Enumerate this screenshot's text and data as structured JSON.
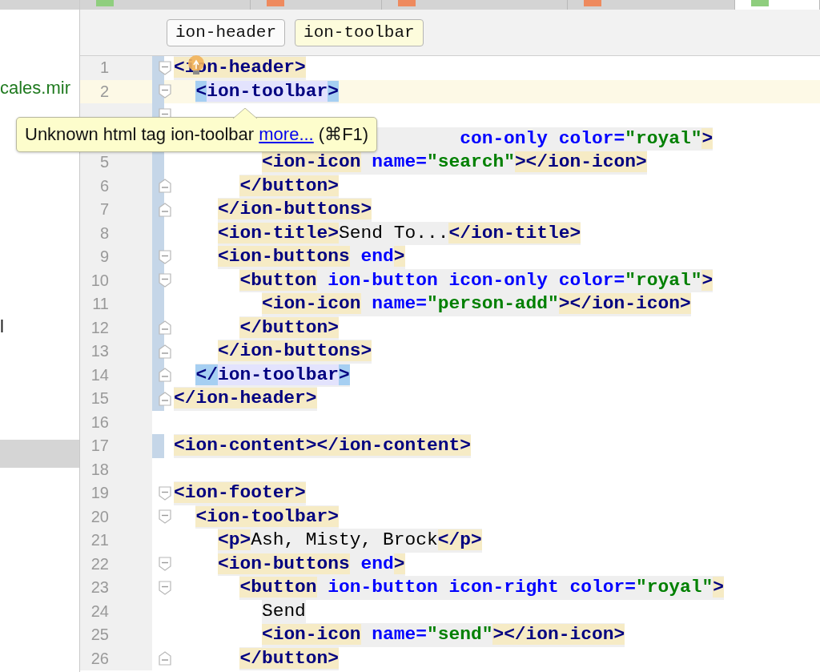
{
  "project_panel": {
    "items": [
      {
        "text": "cales.mir",
        "color": "#1f7a1f",
        "selected": false
      },
      {
        "text": "l",
        "color": "#1a1a1a",
        "selected": false
      },
      {
        "selected": true
      }
    ]
  },
  "editor_tabs": [
    {
      "color": "#8fce7e",
      "selected": false
    },
    {
      "color": "#ee8a5e",
      "selected": false
    },
    {
      "color": "#ee8a5e",
      "selected": false
    },
    {
      "color": "#ee8a5e",
      "selected": false
    },
    {
      "color": "#8fce7e",
      "selected": true
    }
  ],
  "breadcrumbs": [
    {
      "label": "ion-header",
      "selected": false
    },
    {
      "label": "ion-toolbar",
      "selected": true
    }
  ],
  "code": [
    {
      "number": "1",
      "kind": "fold_start",
      "in_scope": true,
      "tokens": [
        {
          "kind": "tag",
          "text": "<ion-header>"
        }
      ],
      "children": [
        {
          "number": "2",
          "kind": "fold_start",
          "in_scope": true,
          "current": true,
          "tokens": [
            {
              "kind": "match_bracket",
              "text": "<"
            },
            {
              "kind": "match_tag",
              "text": "ion-toolbar"
            },
            {
              "kind": "match_bracket",
              "text": ">"
            }
          ],
          "children": [
            {
              "kind": "fold_start",
              "in_scope": true,
              "children": [
                {
                  "tokens": [
                    {
                      "kind": "attr",
                      "text": "                    con-only"
                    },
                    {
                      "kind": "attr",
                      "text": " color="
                    },
                    {
                      "kind": "value",
                      "text": "\"royal\""
                    },
                    {
                      "kind": "tag",
                      "text": ">"
                    }
                  ],
                  "children": [
                    {
                      "number": "5",
                      "in_scope": true,
                      "tokens": [
                        {
                          "kind": "tag",
                          "text": "<ion-icon"
                        },
                        {
                          "kind": "attr",
                          "text": " name="
                        },
                        {
                          "kind": "value",
                          "text": "\"search\""
                        },
                        {
                          "kind": "tag",
                          "text": "></ion-icon>"
                        }
                      ]
                    }
                  ]
                },
                {
                  "number": "6",
                  "kind": "fold_end",
                  "in_scope": true,
                  "tokens": [
                    {
                      "kind": "tag",
                      "text": "</button>"
                    }
                  ]
                }
              ]
            },
            {
              "number": "7",
              "kind": "fold_end",
              "in_scope": true,
              "tokens": [
                {
                  "kind": "tag",
                  "text": "</ion-buttons>"
                }
              ]
            },
            {
              "number": "8",
              "in_scope": true,
              "tokens": [
                {
                  "kind": "tag",
                  "text": "<ion-title>"
                },
                {
                  "kind": "text",
                  "text": "Send To..."
                },
                {
                  "kind": "tag",
                  "text": "</ion-title>"
                }
              ]
            },
            {
              "number": "9",
              "kind": "fold_start",
              "in_scope": true,
              "tokens": [
                {
                  "kind": "tag",
                  "text": "<ion-buttons"
                },
                {
                  "kind": "attr",
                  "text": " end"
                },
                {
                  "kind": "tag",
                  "text": ">"
                }
              ],
              "children": [
                {
                  "number": "10",
                  "kind": "fold_start",
                  "in_scope": true,
                  "tokens": [
                    {
                      "kind": "tag",
                      "text": "<button"
                    },
                    {
                      "kind": "attr",
                      "text": " ion-button"
                    },
                    {
                      "kind": "attr",
                      "text": " icon-only"
                    },
                    {
                      "kind": "attr",
                      "text": " color="
                    },
                    {
                      "kind": "value",
                      "text": "\"royal\""
                    },
                    {
                      "kind": "tag",
                      "text": ">"
                    }
                  ],
                  "children": [
                    {
                      "number": "11",
                      "in_scope": true,
                      "tokens": [
                        {
                          "kind": "tag",
                          "text": "<ion-icon"
                        },
                        {
                          "kind": "attr",
                          "text": " name="
                        },
                        {
                          "kind": "value",
                          "text": "\"person-add\""
                        },
                        {
                          "kind": "tag",
                          "text": "></ion-icon>"
                        }
                      ]
                    }
                  ]
                },
                {
                  "number": "12",
                  "kind": "fold_end",
                  "in_scope": true,
                  "tokens": [
                    {
                      "kind": "tag",
                      "text": "</button>"
                    }
                  ]
                }
              ]
            },
            {
              "number": "13",
              "kind": "fold_end",
              "in_scope": true,
              "tokens": [
                {
                  "kind": "tag",
                  "text": "</ion-buttons>"
                }
              ]
            }
          ]
        },
        {
          "number": "14",
          "kind": "fold_end",
          "in_scope": true,
          "tokens": [
            {
              "kind": "match_bracket",
              "text": "</"
            },
            {
              "kind": "match_tag",
              "text": "ion-toolbar"
            },
            {
              "kind": "match_bracket",
              "text": ">"
            }
          ]
        }
      ]
    },
    {
      "number": "15",
      "kind": "fold_end",
      "in_scope": true,
      "tokens": [
        {
          "kind": "tag",
          "text": "</ion-header>"
        }
      ]
    },
    {
      "number": "16",
      "in_scope": false
    },
    {
      "number": "17",
      "in_scope": true,
      "tokens": [
        {
          "kind": "tag",
          "text": "<ion-content></ion-content>"
        }
      ]
    },
    {
      "number": "18",
      "in_scope": false
    },
    {
      "number": "19",
      "kind": "fold_start",
      "in_scope": false,
      "tokens": [
        {
          "kind": "tag",
          "text": "<ion-footer>"
        }
      ],
      "children": [
        {
          "number": "20",
          "kind": "fold_start",
          "in_scope": false,
          "tokens": [
            {
              "kind": "tag",
              "text": "<ion-toolbar>"
            }
          ],
          "children": [
            {
              "number": "21",
              "in_scope": false,
              "tokens": [
                {
                  "kind": "tag",
                  "text": "<p>"
                },
                {
                  "kind": "text",
                  "text": "Ash, Misty, Brock"
                },
                {
                  "kind": "tag",
                  "text": "</p>"
                }
              ]
            },
            {
              "number": "22",
              "kind": "fold_start",
              "in_scope": false,
              "tokens": [
                {
                  "kind": "tag",
                  "text": "<ion-buttons"
                },
                {
                  "kind": "attr",
                  "text": " end"
                },
                {
                  "kind": "tag",
                  "text": ">"
                }
              ],
              "children": [
                {
                  "number": "23",
                  "kind": "fold_start",
                  "in_scope": false,
                  "tokens": [
                    {
                      "kind": "tag",
                      "text": "<button"
                    },
                    {
                      "kind": "attr",
                      "text": " ion-button"
                    },
                    {
                      "kind": "attr",
                      "text": " icon-right"
                    },
                    {
                      "kind": "attr",
                      "text": " color="
                    },
                    {
                      "kind": "value",
                      "text": "\"royal\""
                    },
                    {
                      "kind": "tag",
                      "text": ">"
                    }
                  ],
                  "children": [
                    {
                      "number": "24",
                      "in_scope": false,
                      "tokens": [
                        {
                          "kind": "text",
                          "text": "Send"
                        }
                      ]
                    },
                    {
                      "number": "25",
                      "in_scope": false,
                      "tokens": [
                        {
                          "kind": "tag",
                          "text": "<ion-icon"
                        },
                        {
                          "kind": "attr",
                          "text": " name="
                        },
                        {
                          "kind": "value",
                          "text": "\"send\""
                        },
                        {
                          "kind": "tag",
                          "text": "></ion-icon>"
                        }
                      ]
                    }
                  ]
                },
                {
                  "number": "26",
                  "kind": "fold_end",
                  "in_scope": false,
                  "tokens": [
                    {
                      "kind": "tag",
                      "text": "</button>"
                    }
                  ]
                }
              ]
            }
          ]
        }
      ]
    }
  ],
  "tooltip": {
    "text": "Unknown html tag ion-toolbar",
    "link": "more...",
    "shortcut": "(⌘F1)"
  }
}
